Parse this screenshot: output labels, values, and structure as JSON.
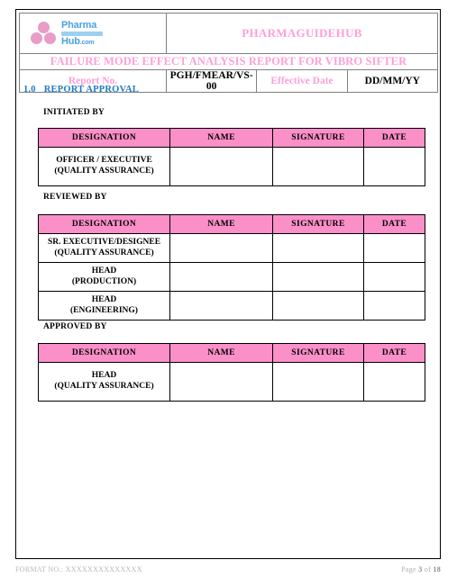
{
  "header": {
    "logo": {
      "line1": "Pharma",
      "line2": "Hub",
      "suffix": ".com",
      "dots_color": "#e89cc8",
      "text_color": "#4aa3e0"
    },
    "brand": "PHARMAGUIDEHUB",
    "document_title": "FAILURE MODE EFFECT ANALYSIS REPORT FOR VIBRO SIFTER",
    "meta": {
      "report_no_label": "Report No.",
      "report_no_value": "PGH/FMEAR/VS-00",
      "effective_date_label": "Effective Date",
      "effective_date_value": "DD/MM/YY"
    },
    "accent_pink": "#ff9fd8"
  },
  "section": {
    "number": "1.0",
    "title": "REPORT APPROVAL",
    "color": "#1f7bc4"
  },
  "table_headers": [
    "DESIGNATION",
    "NAME",
    "SIGNATURE",
    "DATE"
  ],
  "header_fill": "#fb8fc8",
  "blocks": [
    {
      "label": "INITIATED BY",
      "rows": [
        {
          "designation": [
            "OFFICER / EXECUTIVE",
            "(QUALITY ASSURANCE)"
          ],
          "name": "",
          "signature": "",
          "date": ""
        }
      ]
    },
    {
      "label": "REVIEWED BY",
      "rows": [
        {
          "designation": [
            "SR. EXECUTIVE/DESIGNEE",
            "(QUALITY ASSURANCE)"
          ],
          "name": "",
          "signature": "",
          "date": ""
        },
        {
          "designation": [
            "HEAD",
            "(PRODUCTION)"
          ],
          "name": "",
          "signature": "",
          "date": ""
        },
        {
          "designation": [
            "HEAD",
            "(ENGINEERING)"
          ],
          "name": "",
          "signature": "",
          "date": ""
        }
      ]
    },
    {
      "label": "APPROVED BY",
      "rows": [
        {
          "designation": [
            "HEAD",
            "(QUALITY ASSURANCE)"
          ],
          "name": "",
          "signature": "",
          "date": ""
        }
      ]
    }
  ],
  "footer": {
    "format_no": "FORMAT NO.: XXXXXXXXXXXXXX",
    "page_word": "Page",
    "page_current": "3",
    "page_of": "of",
    "page_total": "18"
  }
}
